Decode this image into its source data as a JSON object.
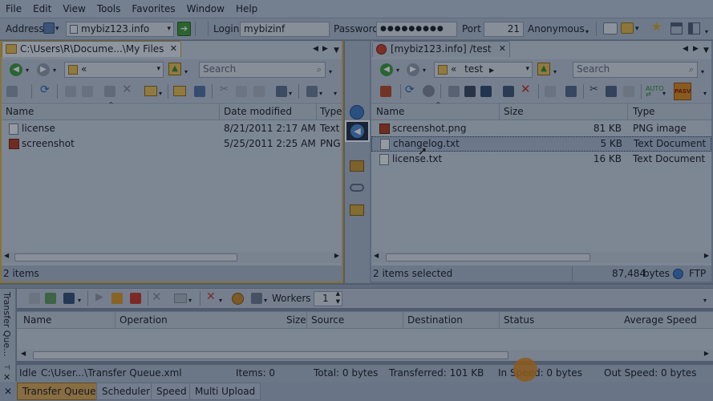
{
  "menu": [
    "File",
    "Edit",
    "View",
    "Tools",
    "Favorites",
    "Window",
    "Help"
  ],
  "address": {
    "label": "Address",
    "value": "mybiz123.info",
    "login_label": "Login",
    "login_value": "mybizinf",
    "password_label": "Password",
    "password_value": "●●●●●●●●●",
    "port_label": "Port",
    "port_value": "21",
    "anonymous_label": "Anonymous"
  },
  "left": {
    "tab_title": "C:\\Users\\R\\Docume...\\My Files",
    "path": "«",
    "search_placeholder": "Search",
    "columns": [
      "Name",
      "Date modified",
      "Type"
    ],
    "files": [
      {
        "name": "license",
        "date": "8/21/2011 2:17 AM",
        "type": "Text"
      },
      {
        "name": "screenshot",
        "date": "5/25/2011 2:25 AM",
        "type": "PNG"
      }
    ],
    "status": "2 items"
  },
  "right": {
    "tab_title": "[mybiz123.info] /test",
    "path_prefix": "«",
    "path": "test",
    "search_placeholder": "Search",
    "pasv": "PASV",
    "columns": [
      "Name",
      "Size",
      "Type"
    ],
    "files": [
      {
        "name": "screenshot.png",
        "size": "81 KB",
        "type": "PNG image"
      },
      {
        "name": "changelog.txt",
        "size": "5 KB",
        "type": "Text Document"
      },
      {
        "name": "license.txt",
        "size": "16 KB",
        "type": "Text Document"
      }
    ],
    "status": "2 items selected",
    "bytes": "87,484",
    "bytes_unit": "bytes",
    "protocol": "FTP"
  },
  "queue": {
    "side_label": "Transfer Que...",
    "workers_label": "Workers",
    "workers_value": "1",
    "columns": [
      "Name",
      "Operation",
      "Size",
      "Source",
      "Destination",
      "Status",
      "Average Speed"
    ],
    "status_idle": "Idle",
    "status_path": "C:\\User...\\Transfer Queue.xml",
    "items": "Items: 0",
    "total": "Total: 0 bytes",
    "transferred": "Transferred: 101 KB",
    "in_speed": "In Speed: 0 bytes",
    "out_speed": "Out Speed: 0 bytes"
  },
  "bottom_tabs": [
    "Transfer Queue",
    "Scheduler",
    "Speed",
    "Multi Upload"
  ],
  "colors": {
    "accent": "#e08a1c",
    "selection": "#9fb4cf",
    "link": "#1e5fb0"
  }
}
